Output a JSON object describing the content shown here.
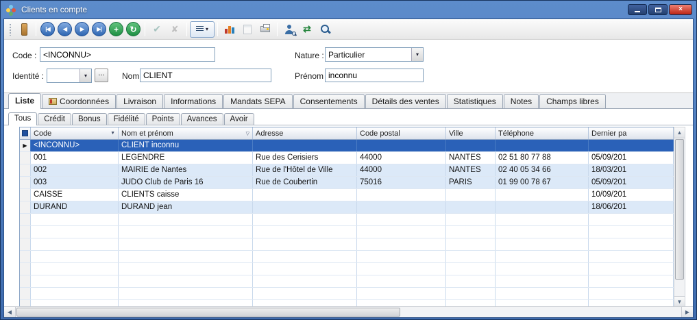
{
  "window": {
    "title": "Clients en compte"
  },
  "icons": {
    "first": "|◀",
    "prev": "◀",
    "next": "▶",
    "last": "▶|",
    "add": "+",
    "refresh": "↻",
    "confirm": "✔",
    "cancel": "✘",
    "dropdown_arrow": "▾",
    "sort_desc": "▼",
    "filter": "▽",
    "row_pointer": "▶",
    "scroll_up": "▲",
    "scroll_down": "▼",
    "scroll_left": "◀",
    "scroll_right": "▶",
    "close": "×",
    "exchange": "⇄"
  },
  "form": {
    "code_label": "Code :",
    "code_value": "<INCONNU>",
    "nature_label": "Nature :",
    "nature_value": "Particulier",
    "identite_label": "Identité :",
    "identite_value": "",
    "browse_label": "...",
    "nom_label": "Nom :",
    "nom_value": "CLIENT",
    "prenom_label": "Prénom :",
    "prenom_value": "inconnu"
  },
  "tabs": {
    "main": [
      {
        "label": "Liste",
        "active": true
      },
      {
        "label": "Coordonnées",
        "icon": "contacts-icon"
      },
      {
        "label": "Livraison"
      },
      {
        "label": "Informations"
      },
      {
        "label": "Mandats SEPA"
      },
      {
        "label": "Consentements"
      },
      {
        "label": "Détails des ventes"
      },
      {
        "label": "Statistiques"
      },
      {
        "label": "Notes"
      },
      {
        "label": "Champs libres"
      }
    ],
    "sub": [
      {
        "label": "Tous",
        "active": true
      },
      {
        "label": "Crédit"
      },
      {
        "label": "Bonus"
      },
      {
        "label": "Fidélité"
      },
      {
        "label": "Points"
      },
      {
        "label": "Avances"
      },
      {
        "label": "Avoir"
      }
    ]
  },
  "grid": {
    "columns": [
      {
        "label": "Code"
      },
      {
        "label": "Nom et prénom"
      },
      {
        "label": "Adresse"
      },
      {
        "label": "Code postal"
      },
      {
        "label": "Ville"
      },
      {
        "label": "Téléphone"
      },
      {
        "label": "Dernier pa"
      }
    ],
    "rows": [
      {
        "code": "<INCONNU>",
        "nom": "CLIENT inconnu",
        "adresse": "",
        "cp": "",
        "ville": "",
        "tel": "",
        "dernier": "",
        "selected": true
      },
      {
        "code": "001",
        "nom": "LEGENDRE",
        "adresse": "Rue des Cerisiers",
        "cp": "44000",
        "ville": "NANTES",
        "tel": "02 51 80 77 88",
        "dernier": "05/09/201"
      },
      {
        "code": "002",
        "nom": "MAIRIE de Nantes",
        "adresse": "Rue de l'Hôtel de Ville",
        "cp": "44000",
        "ville": "NANTES",
        "tel": "02 40 05 34 66",
        "dernier": "18/03/201",
        "shaded": true
      },
      {
        "code": "003",
        "nom": "JUDO Club de Paris 16",
        "adresse": "Rue de Coubertin",
        "cp": "75016",
        "ville": "PARIS",
        "tel": "01 99 00 78 67",
        "dernier": "05/09/201",
        "shaded": true
      },
      {
        "code": "CAISSE",
        "nom": "CLIENTS caisse",
        "adresse": "",
        "cp": "",
        "ville": "",
        "tel": "",
        "dernier": "10/09/201"
      },
      {
        "code": "DURAND",
        "nom": "DURAND jean",
        "adresse": "",
        "cp": "",
        "ville": "",
        "tel": "",
        "dernier": "18/06/201",
        "shaded": true
      }
    ],
    "empty_row_count": 8
  }
}
